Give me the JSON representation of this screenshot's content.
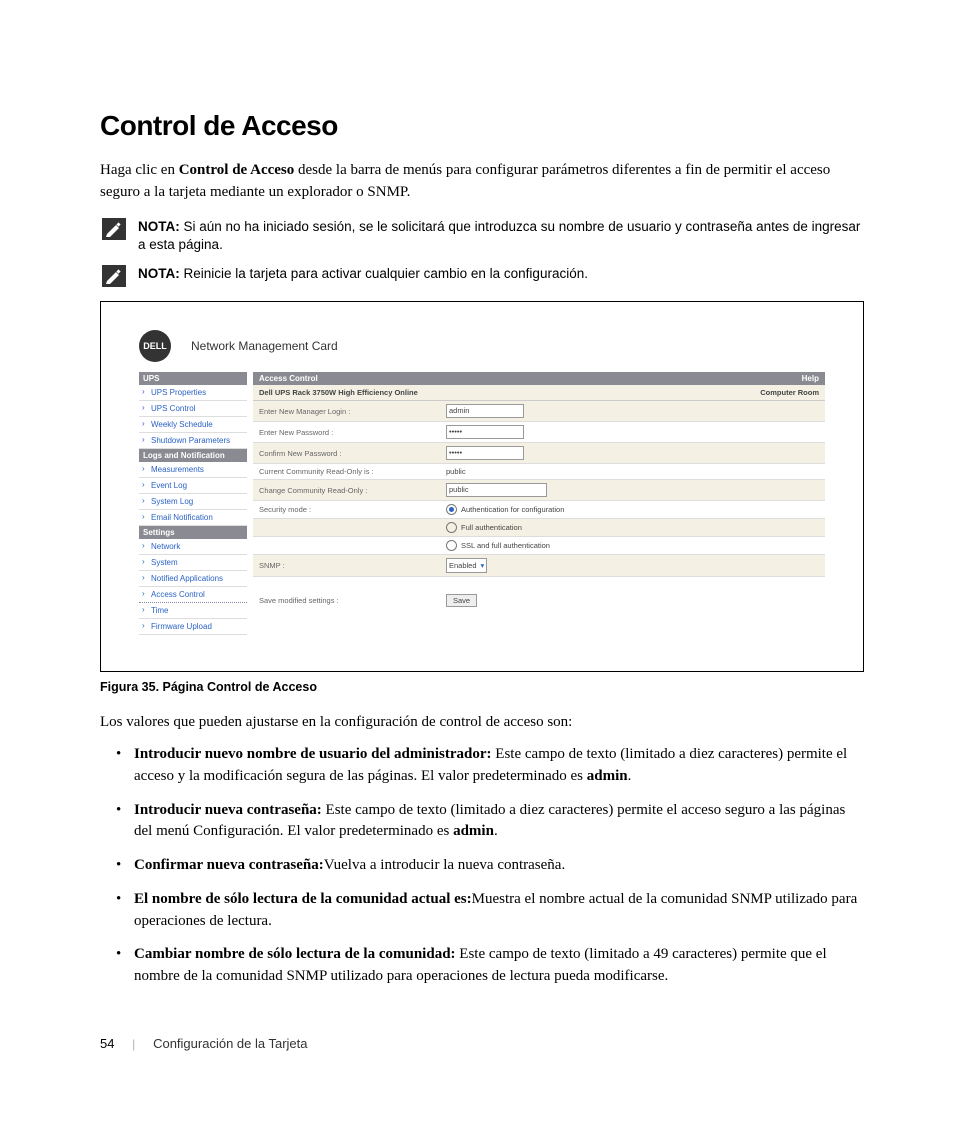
{
  "page_number": "54",
  "footer_section": "Configuración de la Tarjeta",
  "heading": "Control de Acceso",
  "intro_pre": "Haga clic en ",
  "intro_bold": "Control de Acceso",
  "intro_post": " desde la barra de menús para configurar parámetros diferentes a fin de permitir el acceso seguro a la tarjeta mediante un explorador o SNMP.",
  "notes": [
    {
      "label": "NOTA:",
      "text": " Si aún no ha iniciado sesión, se le solicitará que introduzca su nombre de usuario y contraseña antes de ingresar a esta página."
    },
    {
      "label": "NOTA:",
      "text": " Reinicie la tarjeta para activar cualquier cambio en la configuración."
    }
  ],
  "figure": {
    "caption": "Figura 35. Página Control de Acceso",
    "logo_text": "DELL",
    "card_title": "Network Management Card",
    "sidebar": {
      "sections": [
        {
          "title": "UPS",
          "items": [
            "UPS Properties",
            "UPS Control",
            "Weekly Schedule",
            "Shutdown Parameters"
          ]
        },
        {
          "title": "Logs and Notification",
          "items": [
            "Measurements",
            "Event Log",
            "System Log",
            "Email Notification"
          ]
        },
        {
          "title": "Settings",
          "items": [
            "Network",
            "System",
            "Notified Applications",
            "Access Control",
            "Time",
            "Firmware Upload"
          ]
        }
      ],
      "current": "Access Control"
    },
    "pane": {
      "title_left": "Access Control",
      "title_right": "Help",
      "sub_left": "Dell UPS Rack 3750W High Efficiency Online",
      "sub_right": "Computer Room",
      "rows": {
        "login_label": "Enter New Manager Login :",
        "login_value": "admin",
        "pass_label": "Enter New Password :",
        "pass_value": "•••••",
        "confirm_label": "Confirm New Password :",
        "confirm_value": "•••••",
        "comm_ro_label": "Current Community Read-Only is :",
        "comm_ro_value": "public",
        "comm_ro_change_label": "Change Community Read-Only :",
        "comm_ro_change_value": "public",
        "sec_label": "Security mode :",
        "sec_opt1": "Authentication for configuration",
        "sec_opt2": "Full authentication",
        "sec_opt3": "SSL and full authentication",
        "snmp_label": "SNMP :",
        "snmp_value": "Enabled",
        "save_label": "Save modified settings :",
        "save_btn": "Save"
      }
    }
  },
  "after_figure": "Los valores que pueden ajustarse en la configuración de control de acceso son:",
  "bullets": [
    {
      "lead": "Introducir nuevo nombre de usuario del administrador:",
      "text": " Este campo de texto (limitado a diez caracteres) permite el acceso y la modificación segura de las páginas. El valor predeterminado es ",
      "bold_tail": "admin",
      "tail_after": "."
    },
    {
      "lead": "Introducir nueva contraseña:",
      "text": " Este campo de texto (limitado a diez caracteres) permite el acceso seguro a las páginas del menú Configuración. El valor predeterminado es ",
      "bold_tail": "admin",
      "tail_after": "."
    },
    {
      "lead": "Confirmar nueva contraseña:",
      "text": "Vuelva a introducir la nueva contraseña.",
      "bold_tail": "",
      "tail_after": ""
    },
    {
      "lead": "El nombre de sólo lectura de la comunidad actual es:",
      "text": "Muestra el nombre actual de la comunidad SNMP utilizado para operaciones de lectura.",
      "bold_tail": "",
      "tail_after": ""
    },
    {
      "lead": "Cambiar nombre de sólo lectura de la comunidad:",
      "text": " Este campo de texto (limitado a 49 caracteres) permite que el nombre de la comunidad SNMP utilizado para operaciones de lectura pueda modificarse.",
      "bold_tail": "",
      "tail_after": ""
    }
  ]
}
